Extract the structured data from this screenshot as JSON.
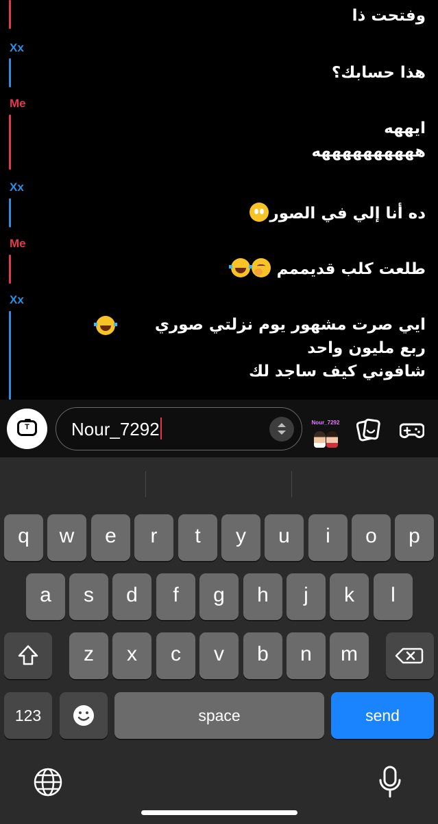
{
  "chat": {
    "messages": [
      {
        "sender": "",
        "text": "وفتحت ذا"
      },
      {
        "sender": "Xx",
        "text": "هذا حسابك؟"
      },
      {
        "sender": "Me",
        "text": "ايههه\nههههههههههه"
      },
      {
        "sender": "Xx",
        "text": "ده أنا إلي في الصور"
      },
      {
        "sender": "Me",
        "text": "طلعت كلب قديممم"
      },
      {
        "sender": "Xx",
        "text": "ايي صرت مشهور يوم نزلتي صوري\nربع مليون واحد\nشافوني كيف ساجد لك"
      }
    ],
    "colors": {
      "xx": "#2d8fe0",
      "me": "#e5394f"
    }
  },
  "input": {
    "value": "Nour_7292",
    "camera_icon_letter": "T",
    "bitmoji_label": "Nour_7292"
  },
  "keyboard": {
    "row1": [
      "q",
      "w",
      "e",
      "r",
      "t",
      "y",
      "u",
      "i",
      "o",
      "p"
    ],
    "row2": [
      "a",
      "s",
      "d",
      "f",
      "g",
      "h",
      "j",
      "k",
      "l"
    ],
    "row3": [
      "z",
      "x",
      "c",
      "v",
      "b",
      "n",
      "m"
    ],
    "numbers_label": "123",
    "space_label": "space",
    "send_label": "send",
    "send_color": "#1a84ff"
  }
}
